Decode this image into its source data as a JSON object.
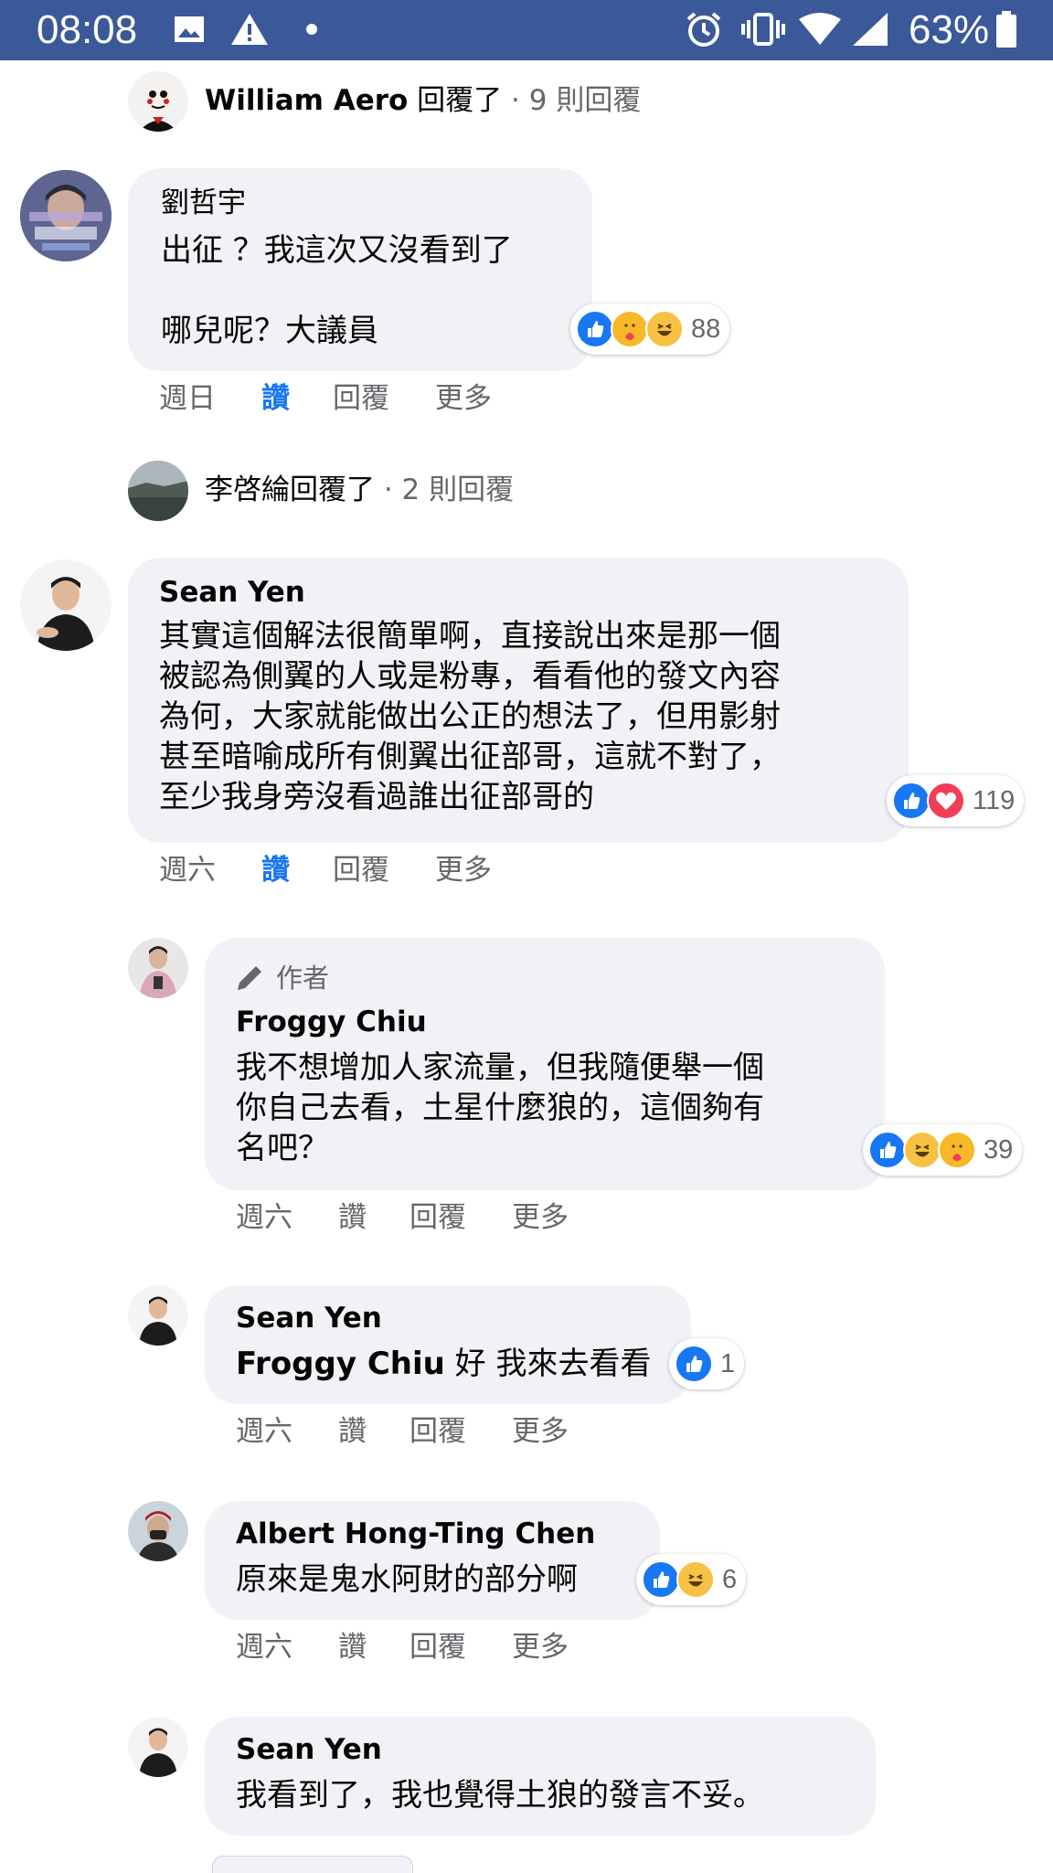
{
  "status_bar": {
    "time": "08:08",
    "battery": "63%"
  },
  "reply_summaries": [
    {
      "name": "William Aero",
      "text": " 回覆了",
      "count": " · 9 則回覆"
    },
    {
      "name": "李啓綸回覆了",
      "count": " · 2 則回覆"
    }
  ],
  "comments": [
    {
      "author": "劉哲宇",
      "lines": [
        "出征 ？我這次又沒看到了",
        "",
        "哪兒呢？大議員"
      ],
      "reactions_count": "88",
      "time": "週日",
      "like": "讚",
      "reply": "回覆",
      "more": "更多"
    },
    {
      "author": "Sean Yen",
      "lines": [
        "其實這個解法很簡單啊，直接說出來是那一個",
        "被認為側翼的人或是粉專，看看他的發文內容",
        "為何，大家就能做出公正的想法了，但用影射",
        "甚至暗喻成所有側翼出征部哥，這就不對了，",
        "至少我身旁沒看過誰出征部哥的"
      ],
      "reactions_count": "119",
      "time": "週六",
      "like": "讚",
      "reply": "回覆",
      "more": "更多"
    },
    {
      "badge": "作者",
      "author": "Froggy Chiu",
      "lines": [
        "我不想增加人家流量，但我隨便舉一個",
        "你自己去看，土星什麼狼的，這個夠有",
        "名吧？"
      ],
      "reactions_count": "39",
      "time": "週六",
      "like": "讚",
      "reply": "回覆",
      "more": "更多"
    },
    {
      "author": "Sean Yen",
      "mention": "Froggy Chiu",
      "text": " 好 我來去看看",
      "reactions_count": "1",
      "time": "週六",
      "like": "讚",
      "reply": "回覆",
      "more": "更多"
    },
    {
      "author": "Albert Hong-Ting Chen",
      "text": "原來是鬼水阿財的部分啊",
      "reactions_count": "6",
      "time": "週六",
      "like": "讚",
      "reply": "回覆",
      "more": "更多"
    },
    {
      "author": "Sean Yen",
      "text": "我看到了，我也覺得土狼的發言不妥。"
    }
  ],
  "colors": {
    "status_bar": "#3b5998",
    "like_blue": "#1877f2",
    "bubble": "#f0f2f5",
    "meta_grey": "#65676b"
  }
}
